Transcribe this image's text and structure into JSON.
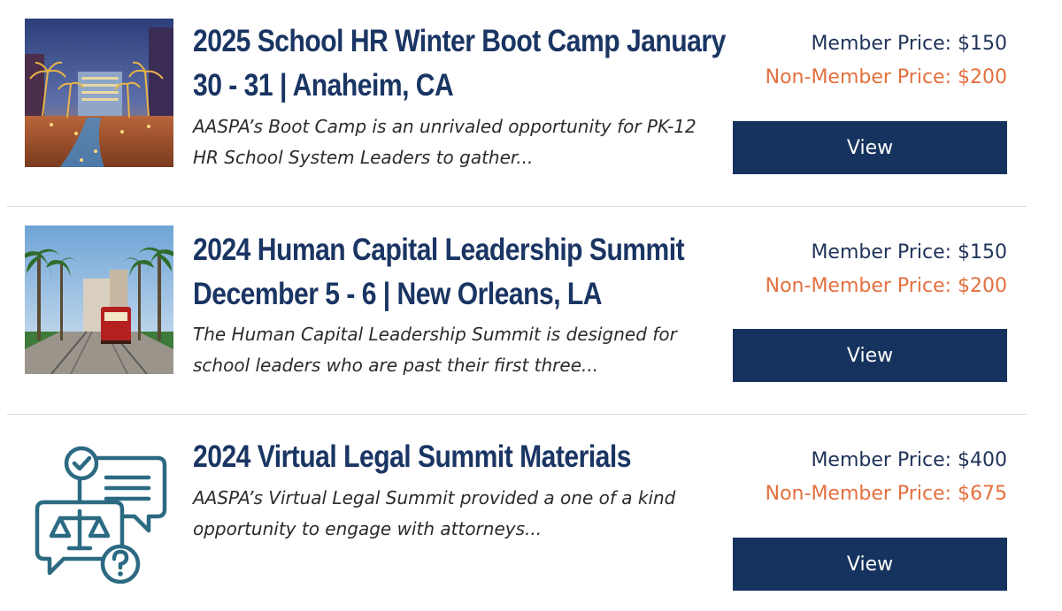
{
  "items": [
    {
      "title": "2025 School HR Winter Boot Camp January 30 - 31 | Anaheim, CA",
      "description": "AASPA’s Boot Camp is an unrivaled opportunity for PK-12 HR School System Leaders to gather...",
      "member_price": "Member Price: $150",
      "non_member_price": "Non-Member Price: $200",
      "button_label": "View"
    },
    {
      "title": "2024 Human Capital Leadership Summit December 5 - 6 | New Orleans, LA",
      "description": "The Human Capital Leadership Summit is designed for school leaders who are past their first three...",
      "member_price": "Member Price: $150",
      "non_member_price": "Non-Member Price: $200",
      "button_label": "View"
    },
    {
      "title": "2024 Virtual Legal Summit Materials",
      "description": "AASPA’s Virtual Legal Summit provided a one of a kind opportunity to engage with attorneys...",
      "member_price": "Member Price: $400",
      "non_member_price": "Non-Member Price: $675",
      "button_label": "View"
    }
  ],
  "colors": {
    "title": "#1a3563",
    "member_price": "#1f3358",
    "non_member_price": "#e3703f",
    "button_bg": "#15335e",
    "icon_teal": "#2b6a82"
  }
}
